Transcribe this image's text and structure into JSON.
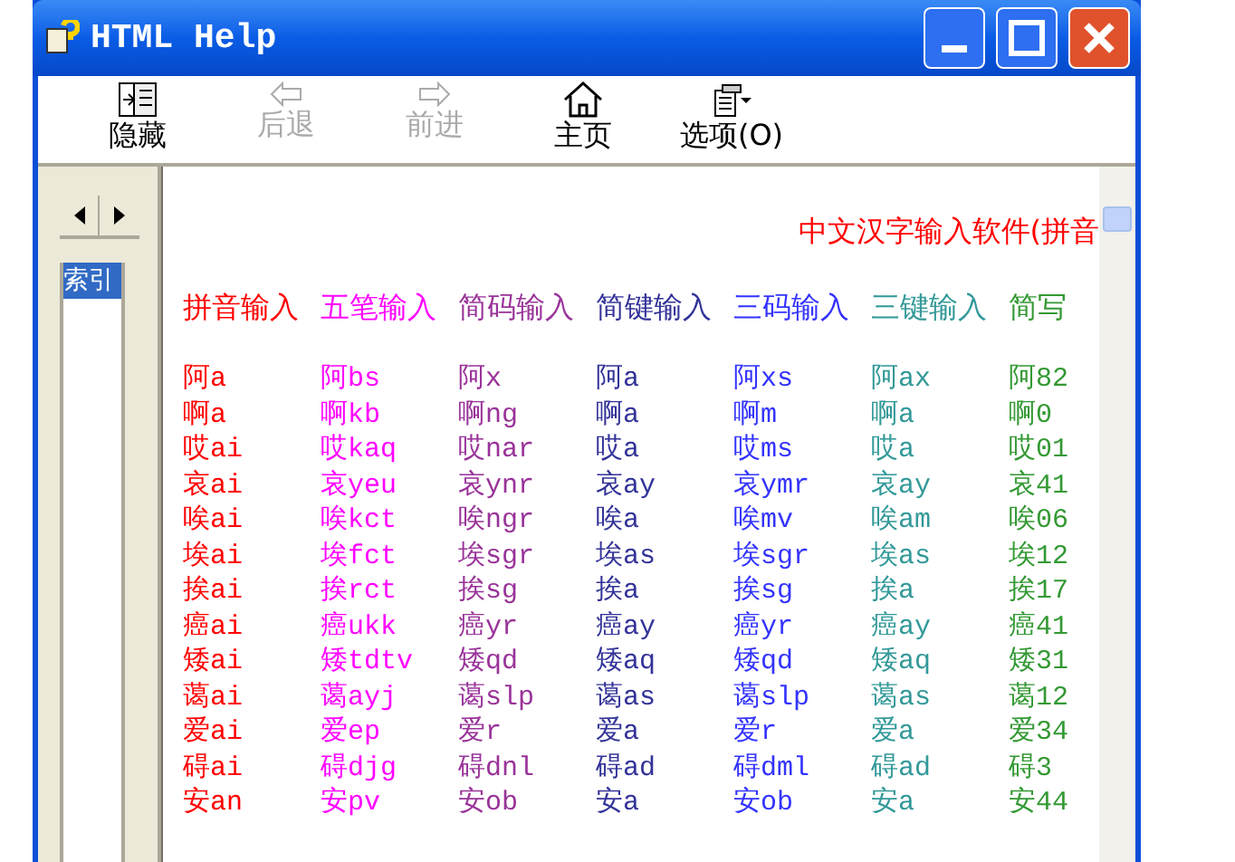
{
  "window": {
    "title": "HTML Help"
  },
  "toolbar": [
    {
      "label": "隐藏",
      "kind": "hide",
      "disabled": false
    },
    {
      "label": "后退",
      "kind": "back",
      "disabled": true
    },
    {
      "label": "前进",
      "kind": "forward",
      "disabled": true
    },
    {
      "label": "主页",
      "kind": "home",
      "disabled": false
    },
    {
      "label": "选项(O)",
      "kind": "options",
      "disabled": false
    }
  ],
  "nav_tabs": [
    {
      "label": "索引",
      "selected": true
    }
  ],
  "content": {
    "heading": "中文汉字输入软件(拼音",
    "columns": [
      {
        "heading": "拼音输入",
        "color": "#ff0000",
        "cells": [
          "阿a",
          "啊a",
          "哎ai",
          "哀ai",
          "唉ai",
          "埃ai",
          "挨ai",
          "癌ai",
          "矮ai",
          "蔼ai",
          "爱ai",
          "碍ai",
          "安an"
        ]
      },
      {
        "heading": "五笔输入",
        "color": "#ff00ff",
        "cells": [
          "阿bs",
          "啊kb",
          "哎kaq",
          "哀yeu",
          "唉kct",
          "埃fct",
          "挨rct",
          "癌ukk",
          "矮tdtv",
          "蔼ayj",
          "爱ep",
          "碍djg",
          "安pv"
        ]
      },
      {
        "heading": "简码输入",
        "color": "#993399",
        "cells": [
          "阿x",
          "啊ng",
          "哎nar",
          "哀ynr",
          "唉ngr",
          "埃sgr",
          "挨sg",
          "癌yr",
          "矮qd",
          "蔼slp",
          "爱r",
          "碍dnl",
          "安ob"
        ]
      },
      {
        "heading": "简键输入",
        "color": "#333399",
        "cells": [
          "阿a",
          "啊a",
          "哎a",
          "哀ay",
          "唉a",
          "埃as",
          "挨a",
          "癌ay",
          "矮aq",
          "蔼as",
          "爱a",
          "碍ad",
          "安a"
        ]
      },
      {
        "heading": "三码输入",
        "color": "#3333ff",
        "cells": [
          "阿xs",
          "啊m",
          "哎ms",
          "哀ymr",
          "唉mv",
          "埃sgr",
          "挨sg",
          "癌yr",
          "矮qd",
          "蔼slp",
          "爱r",
          "碍dml",
          "安ob"
        ]
      },
      {
        "heading": "三键输入",
        "color": "#339999",
        "cells": [
          "阿ax",
          "啊a",
          "哎a",
          "哀ay",
          "唉am",
          "埃as",
          "挨a",
          "癌ay",
          "矮aq",
          "蔼as",
          "爱a",
          "碍ad",
          "安a"
        ]
      },
      {
        "heading": "简写",
        "color": "#339933",
        "cells": [
          "阿82",
          "啊0",
          "哎01",
          "哀41",
          "唉06",
          "埃12",
          "挨17",
          "癌41",
          "矮31",
          "蔼12",
          "爱34",
          "碍3",
          "安44"
        ]
      }
    ]
  }
}
